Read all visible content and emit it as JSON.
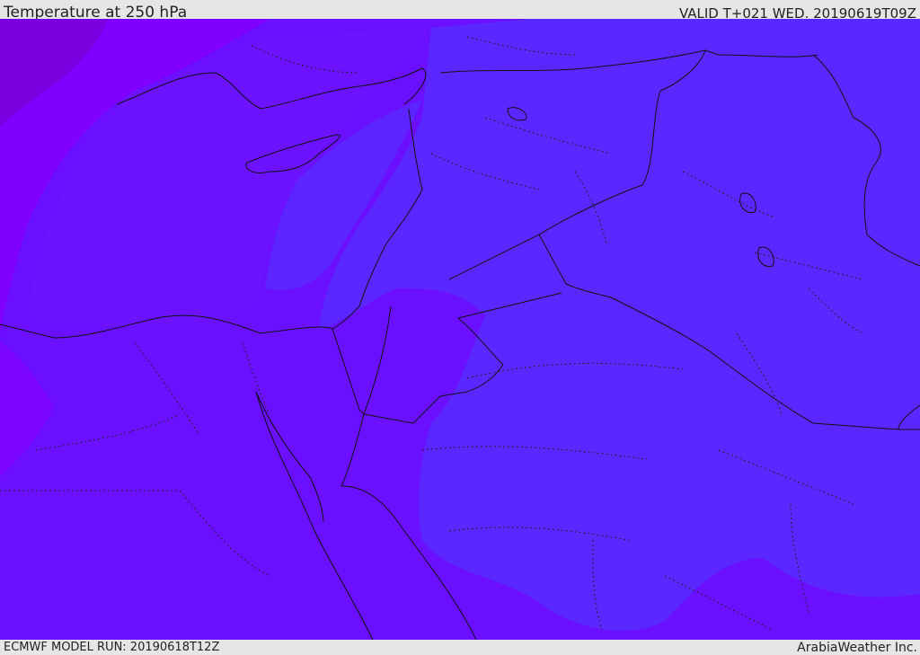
{
  "header": {
    "title": "Temperature at 250 hPa",
    "valid_time": "VALID T+021 WED. 20190619T09Z"
  },
  "footer": {
    "model_run": "ECMWF MODEL RUN: 20190618T12Z",
    "credit": "ArabiaWeather Inc."
  },
  "map": {
    "field": "Temperature at 250 hPa",
    "colors": {
      "coldest_purple": "#8000ff",
      "violet": "#6e14ff",
      "indigo": "#6a10ff",
      "blue_violet": "#5a28ff",
      "deep_purple_nw": "#7a00e0",
      "border_line": "#111111"
    },
    "legend_visible": false
  }
}
